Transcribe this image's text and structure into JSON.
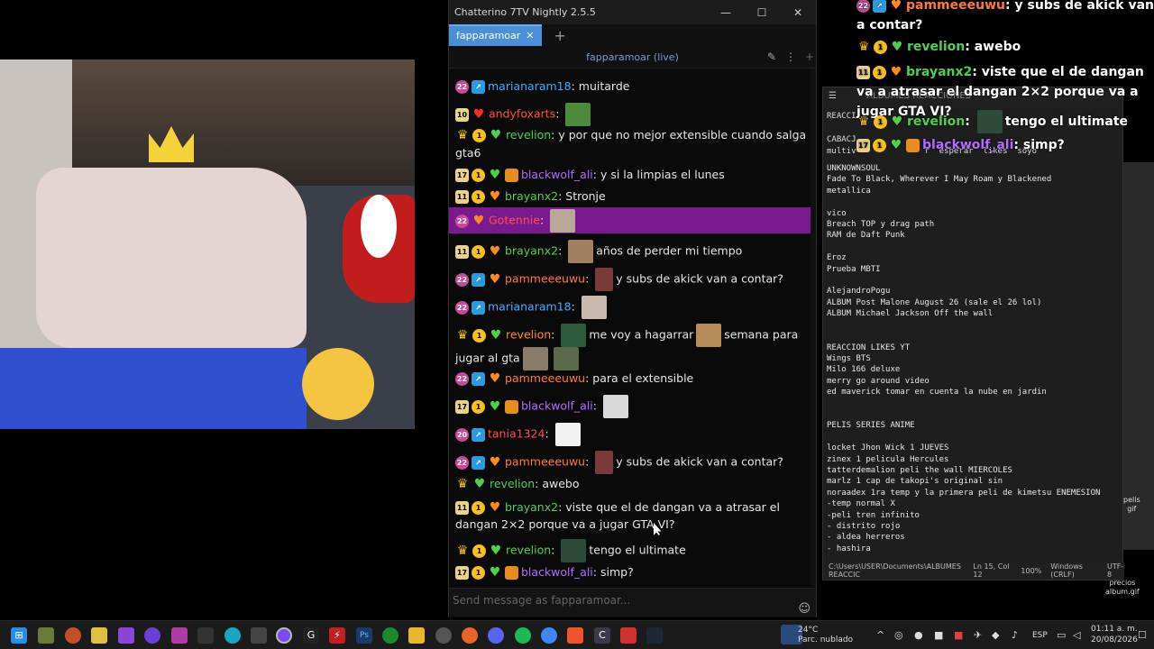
{
  "chatterino": {
    "title": "Chatterino 7TV Nightly 2.5.5",
    "tab_label": "fapparamoar",
    "channel_header": "fapparamoar (live)",
    "input_placeholder": "Send message as fapparamoar...",
    "messages": [
      {
        "user": "marianaram18",
        "color": "#4aa8ff",
        "text": "muitarde"
      },
      {
        "user": "andyfoxarts",
        "color": "#ff4d4d",
        "text": ""
      },
      {
        "user": "revelion",
        "color": "#4fd04f",
        "text": "y por que no mejor extensible cuando salga gta6"
      },
      {
        "user": "blackwolf_ali",
        "color": "#b36cff",
        "text": "y si la limpias el lunes"
      },
      {
        "user": "brayanx2",
        "color": "#4fd04f",
        "text": "Stronje"
      },
      {
        "user": "Gotennie",
        "color": "#ff4d4d",
        "text": ""
      },
      {
        "user": "brayanx2",
        "color": "#4fd04f",
        "text": "años de perder mi tiempo"
      },
      {
        "user": "pammeeeuwu",
        "color": "#ff7a3a",
        "text": "y subs de akick van a contar?"
      },
      {
        "user": "marianaram18",
        "color": "#4aa8ff",
        "text": ""
      },
      {
        "user": "revelion",
        "color": "#4fd04f",
        "text": "me voy a hagarrar",
        "text2": "semana para jugar al gta"
      },
      {
        "user": "pammeeeuwu",
        "color": "#ff7a3a",
        "text": "para el extensible"
      },
      {
        "user": "blackwolf_ali",
        "color": "#b36cff",
        "text": ""
      },
      {
        "user": "tania1324",
        "color": "#ff4d4d",
        "text": ""
      },
      {
        "user": "pammeeeuwu",
        "color": "#ff7a3a",
        "text": "y subs de akick van a contar?"
      },
      {
        "user": "revelion",
        "color": "#4fd04f",
        "text": "awebo"
      },
      {
        "user": "brayanx2",
        "color": "#4fd04f",
        "text": "viste que el de dangan va a atrasar el dangan 2×2 porque va a jugar GTA VI?"
      },
      {
        "user": "revelion",
        "color": "#4fd04f",
        "text": "tengo el ultimate"
      },
      {
        "user": "blackwolf_ali",
        "color": "#b36cff",
        "text": "simp?"
      }
    ],
    "badges": {
      "sub_10": "10",
      "sub_11": "11",
      "sub_17": "17",
      "sub_20": "20",
      "sub_22": "22",
      "bits": "1"
    }
  },
  "overlay": {
    "messages": [
      {
        "user": "pammeeeuwu",
        "color": "#ff7a3a",
        "text": "y subs de akick van a contar?"
      },
      {
        "user": "revelion",
        "color": "#4fd04f",
        "text": "awebo"
      },
      {
        "user": "brayanx2",
        "color": "#4fd04f",
        "text": "viste que el de dangan va a atrasar el dangan 2×2 porque va a jugar GTA VI?"
      },
      {
        "user": "revelion",
        "color": "#4fd04f",
        "text": "tengo el ultimate"
      },
      {
        "user": "blackwolf_ali",
        "color": "#b36cff",
        "text": "simp?"
      }
    ],
    "badges": {
      "sub_11": "11",
      "sub_17": "17",
      "sub_22": "22",
      "bits": "1"
    }
  },
  "notepad": {
    "menu_label": "ALBUMES REACCIONES",
    "head_lines": "REACCI\n\nCABACJ\nmultiv              r  esperar  likes  soyo",
    "body": "UNKNOWNSOUL\nFade To Black, Wherever I May Roam y Blackened\nmetallica\n\nvico\nBreach TOP y drag path\nRAM de Daft Punk\n\nEroz\nPrueba MBTI\n\nAlejandroPogu\nALBUM Post Malone August 26 (sale el 26 lol)\nALBUM Michael Jackson Off the wall\n\n\nREACCION LIKES YT\nWings BTS\nMilo 166 deluxe\nmerry go around video\ned maverick tomar en cuenta la nube en jardin\n\n\nPELIS SERIES ANIME\n\nlocket Jhon Wick 1 JUEVES\nzinex 1 pelicula Hercules\ntatterdemalion peli the wall MIERCOLES\nmarlz 1 cap de takopi's original sin\nnoraadex 1ra temp y la primera peli de kimetsu ENEMESION\n-temp normal X\n-peli tren infinito\n- distrito rojo\n- aldea herreros\n- hashira",
    "status_path": "C:\\Users\\USER\\Documents\\ALBUMES REACCIC",
    "status_pos": "Ln 15, Col 12",
    "status_zoom": "100%",
    "status_eol": "Windows (CRLF)",
    "status_enc": "UTF-8"
  },
  "corner_file": "precios\nalbum.gif",
  "corner_file2": "pelis\ngif",
  "taskbar": {
    "weather_temp": "24°C",
    "weather_desc": "Parc. nublado",
    "lang": "ESP",
    "time": "01:11 a. m.",
    "date": "20/08/2026"
  }
}
